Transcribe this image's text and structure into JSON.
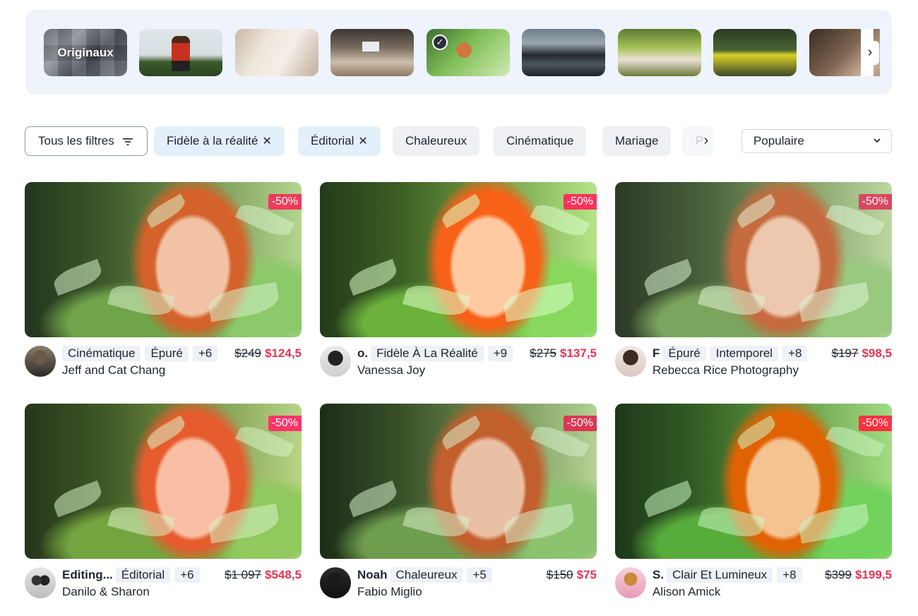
{
  "carousel": {
    "items": [
      {
        "label": "Originaux",
        "selected": false
      },
      {
        "label": "",
        "selected": false
      },
      {
        "label": "",
        "selected": false
      },
      {
        "label": "",
        "selected": false
      },
      {
        "label": "",
        "selected": true
      },
      {
        "label": "",
        "selected": false
      },
      {
        "label": "",
        "selected": false
      },
      {
        "label": "",
        "selected": false
      },
      {
        "label": "",
        "selected": false
      }
    ],
    "check_glyph": "✓",
    "next_glyph": "›"
  },
  "filters": {
    "all_label": "Tous les filtres",
    "chips": [
      {
        "label": "Fidèle à la réalité",
        "active": true
      },
      {
        "label": "Éditorial",
        "active": true
      },
      {
        "label": "Chaleureux",
        "active": false
      },
      {
        "label": "Cinématique",
        "active": false
      },
      {
        "label": "Mariage",
        "active": false
      }
    ],
    "remove_glyph": "✕",
    "partial_chip": "P",
    "next_glyph": "›"
  },
  "sort": {
    "selected": "Populaire",
    "chevron": "⌄"
  },
  "discount_label": "-50%",
  "cards": [
    {
      "name_short": "",
      "tags": [
        "Cinématique",
        "Épuré"
      ],
      "more": "+6",
      "old_price": "$249",
      "new_price": "$124,5",
      "author": "Jeff and Cat Chang"
    },
    {
      "name_short": "o.",
      "tags": [
        "Fidèle À La Réalité"
      ],
      "more": "+9",
      "old_price": "$275",
      "new_price": "$137,5",
      "author": "Vanessa Joy"
    },
    {
      "name_short": "F",
      "tags": [
        "Épuré",
        "Intemporel"
      ],
      "more": "+8",
      "old_price": "$197",
      "new_price": "$98,5",
      "author": "Rebecca Rice Photography"
    },
    {
      "name_short": "Editing...",
      "tags": [
        "Éditorial"
      ],
      "more": "+6",
      "old_price": "$1 097",
      "new_price": "$548,5",
      "author": "Danilo & Sharon"
    },
    {
      "name_short": "Noah",
      "tags": [
        "Chaleureux"
      ],
      "more": "+5",
      "old_price": "$150",
      "new_price": "$75",
      "author": "Fabio Miglio"
    },
    {
      "name_short": "S.",
      "tags": [
        "Clair Et Lumineux"
      ],
      "more": "+8",
      "old_price": "$399",
      "new_price": "$199,5",
      "author": "Alison Amick"
    }
  ]
}
